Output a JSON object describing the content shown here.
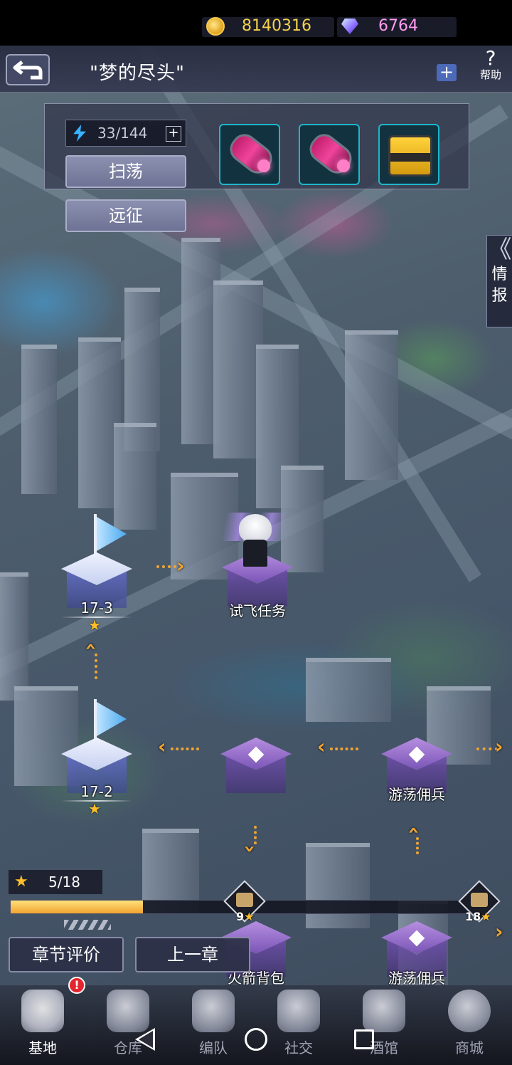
{
  "header": {
    "chapter_title": "\"梦的尽头\"",
    "gold": "8140316",
    "gems": "6764",
    "plus": "+",
    "help": "帮助"
  },
  "sweep": {
    "energy": "33/144",
    "energy_plus": "+",
    "sweep_button": "扫荡",
    "expedition_button": "远征",
    "rewards": [
      "pink-capsule-icon",
      "pink-capsule-icon",
      "yellow-crate-icon"
    ]
  },
  "side_tab": {
    "label": "情报",
    "chevron": "《"
  },
  "nodes": {
    "stage_17_3": {
      "label": "17-3",
      "stars": "★"
    },
    "test_flight": {
      "label": "试飞任务"
    },
    "stage_17_2": {
      "label": "17-2",
      "stars": "★"
    },
    "wandering_merc_1": {
      "label": "游荡佣兵"
    },
    "jetpack": {
      "label": "火箭背包"
    },
    "wandering_merc_2": {
      "label": "游荡佣兵"
    }
  },
  "progress": {
    "star": "★",
    "text": "5/18",
    "current": 5,
    "total": 18,
    "milestones": [
      {
        "value": "9",
        "star": "★"
      },
      {
        "value": "18",
        "star": "★"
      }
    ]
  },
  "actions": {
    "chapter_rating": "章节评价",
    "previous_chapter": "上一章"
  },
  "bottom_nav": {
    "badge": "!",
    "items": [
      {
        "label": "基地",
        "active": true
      },
      {
        "label": "仓库"
      },
      {
        "label": "编队"
      },
      {
        "label": "社交"
      },
      {
        "label": "酒馆"
      },
      {
        "label": "商城"
      }
    ]
  },
  "colors": {
    "accent_gold": "#f5d34a",
    "progress_fill": "#f2a431",
    "star": "#ffbf2a",
    "badge": "#e3262f"
  }
}
